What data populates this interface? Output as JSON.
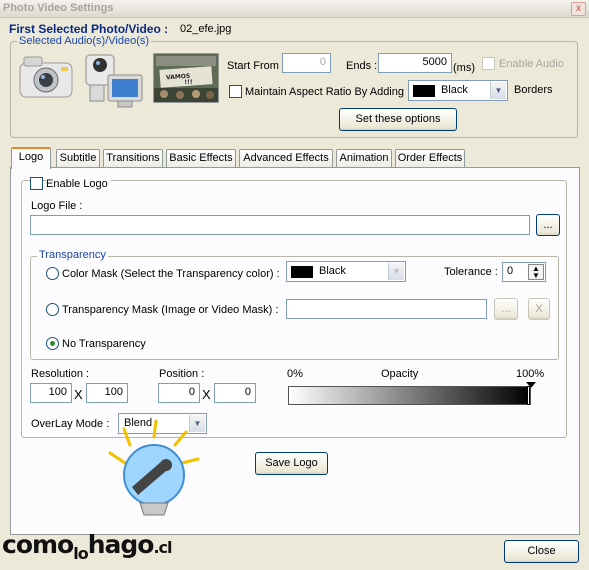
{
  "window": {
    "title": "Photo Video Settings",
    "close_glyph": "x"
  },
  "header": {
    "first_selected_label": "First Selected Photo/Video :",
    "first_selected_value": "02_efe.jpg"
  },
  "media_group": {
    "label": "Selected Audio(s)/Video(s)",
    "thumbnail_icons": [
      "camera-icon",
      "video-camera-monitor-icon",
      "photo-thumbnail"
    ],
    "start_from_label": "Start From :",
    "start_from_value": "0",
    "ends_label": "Ends :",
    "ends_value": "5000",
    "ends_unit": "(ms)",
    "enable_audio_label": "Enable Audio",
    "maintain_aspect_label": "Maintain Aspect Ratio By Adding",
    "border_color_value": "Black",
    "borders_label": "Borders",
    "set_options_button": "Set these options"
  },
  "tabs": [
    {
      "label": "Logo",
      "active": true
    },
    {
      "label": "Subtitle",
      "active": false
    },
    {
      "label": "Transitions",
      "active": false
    },
    {
      "label": "Basic Effects",
      "active": false
    },
    {
      "label": "Advanced Effects",
      "active": false
    },
    {
      "label": "Animation",
      "active": false
    },
    {
      "label": "Order Effects",
      "active": false
    }
  ],
  "logo_panel": {
    "enable_logo_label": "Enable Logo",
    "logo_file_label": "Logo File :",
    "logo_file_value": "",
    "browse_button": "...",
    "transparency": {
      "label": "Transparency",
      "color_mask_label": "Color Mask (Select the Transparency color) :",
      "color_mask_value": "Black",
      "tolerance_label": "Tolerance :",
      "tolerance_value": "0",
      "transparency_mask_label": "Transparency Mask (Image or Video Mask) :",
      "transparency_mask_value": "",
      "mask_browse_button": "...",
      "mask_clear_button": "X",
      "no_transparency_label": "No Transparency",
      "selected_option": "no-transparency"
    },
    "resolution_label": "Resolution :",
    "resolution_width": "100",
    "resolution_height": "100",
    "times_sign": "X",
    "position_label": "Position :",
    "position_x": "0",
    "position_y": "0",
    "opacity_min_label": "0%",
    "opacity_label": "Opacity",
    "opacity_max_label": "100%",
    "opacity_value_percent": 100,
    "overlay_mode_label": "OverLay Mode :",
    "overlay_mode_value": "Blend",
    "save_logo_button": "Save Logo"
  },
  "footer": {
    "close_button": "Close"
  },
  "watermark": {
    "text_como": "como",
    "text_lo": "lo",
    "text_hago": "hago",
    "text_cl": ".cl"
  },
  "colors": {
    "title_blue": "#0a2a86",
    "group_blue": "#1b45a8",
    "tab_highlight": "#e68b2c",
    "window_bg": "#ece9d8"
  }
}
